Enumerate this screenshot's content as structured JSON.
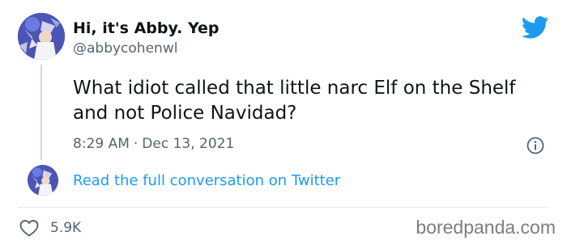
{
  "tweet": {
    "display_name": "Hi, it's Abby. Yep",
    "handle": "@abbycohenwl",
    "text": "What idiot called that little narc Elf on the Shelf and not Police Navidad?",
    "time": "8:29 AM",
    "separator": "·",
    "date": "Dec 13, 2021",
    "read_full_label": "Read the full conversation on Twitter",
    "likes": "5.9K"
  },
  "icons": {
    "brand": "twitter-bird-icon",
    "info": "info-icon",
    "like": "heart-icon"
  },
  "watermark": "boredpanda.com",
  "colors": {
    "twitter_blue": "#1d9bf0",
    "muted_text": "#536471",
    "primary_text": "#0f1419"
  }
}
